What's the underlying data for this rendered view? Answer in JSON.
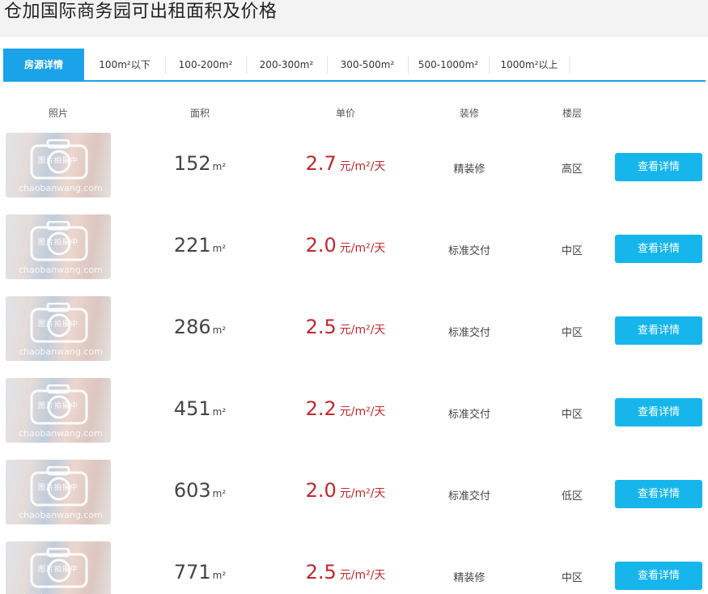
{
  "page_title": "仓加国际商务园可出租面积及价格",
  "tabs": [
    {
      "label": "房源详情",
      "active": true
    },
    {
      "label": "100m²以下",
      "active": false
    },
    {
      "label": "100-200m²",
      "active": false
    },
    {
      "label": "200-300m²",
      "active": false
    },
    {
      "label": "300-500m²",
      "active": false
    },
    {
      "label": "500-1000m²",
      "active": false
    },
    {
      "label": "1000m²以上",
      "active": false
    }
  ],
  "columns": {
    "photo": "照片",
    "area": "面积",
    "price": "单价",
    "decoration": "装修",
    "floor": "楼层"
  },
  "thumb": {
    "overlay_text": "图片拍摄中",
    "watermark": "chaobanwang.com"
  },
  "area_unit": "m²",
  "price_unit": "元/m²/天",
  "button_label": "查看详情",
  "listings": [
    {
      "area": "152",
      "price": "2.7",
      "decoration": "精装修",
      "floor": "高区"
    },
    {
      "area": "221",
      "price": "2.0",
      "decoration": "标准交付",
      "floor": "中区"
    },
    {
      "area": "286",
      "price": "2.5",
      "decoration": "标准交付",
      "floor": "中区"
    },
    {
      "area": "451",
      "price": "2.2",
      "decoration": "标准交付",
      "floor": "中区"
    },
    {
      "area": "603",
      "price": "2.0",
      "decoration": "标准交付",
      "floor": "低区"
    },
    {
      "area": "771",
      "price": "2.5",
      "decoration": "精装修",
      "floor": "中区"
    }
  ],
  "colors": {
    "accent": "#1aa3e8",
    "button": "#16b6ec",
    "price": "#c0272d"
  }
}
